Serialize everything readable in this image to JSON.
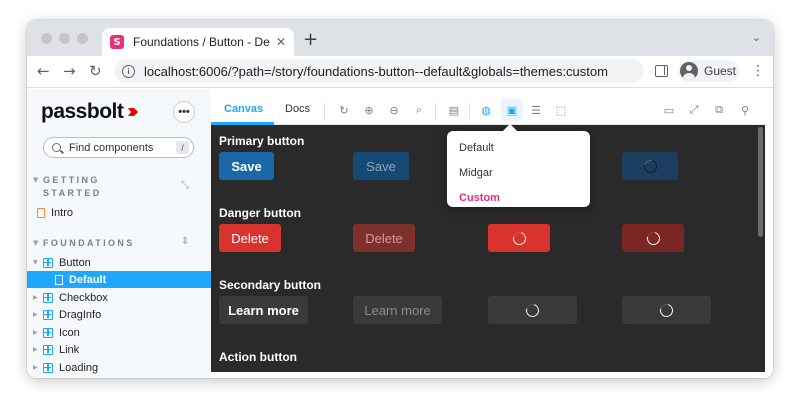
{
  "browser": {
    "tab_title": "Foundations / Button - Default",
    "favicon_letter": "S",
    "url": "localhost:6006/?path=/story/foundations-button--default&globals=themes:custom",
    "profile_label": "Guest"
  },
  "sidebar": {
    "logo": "passbolt",
    "search_placeholder": "Find components",
    "search_shortcut": "/",
    "groups": [
      {
        "label": "GETTING",
        "label2": "STARTED",
        "items": [
          {
            "label": "Intro",
            "icon": "doc-icon"
          }
        ]
      },
      {
        "label": "FOUNDATIONS"
      }
    ],
    "tree": [
      {
        "label": "Button",
        "icon": "component-icon",
        "expanded": true
      },
      {
        "label": "Default",
        "icon": "story-icon",
        "selected": true
      },
      {
        "label": "Checkbox",
        "icon": "component-icon"
      },
      {
        "label": "DragInfo",
        "icon": "component-icon"
      },
      {
        "label": "Icon",
        "icon": "component-icon"
      },
      {
        "label": "Link",
        "icon": "component-icon"
      },
      {
        "label": "Loading",
        "icon": "component-icon"
      }
    ]
  },
  "toolbar": {
    "tabs": [
      "Canvas",
      "Docs"
    ],
    "active_tab": "Canvas"
  },
  "theme_menu": {
    "options": [
      "Default",
      "Midgar",
      "Custom"
    ],
    "selected": "Custom"
  },
  "canvas": {
    "sections": [
      {
        "title": "Primary button",
        "label": "Save"
      },
      {
        "title": "Danger button",
        "label": "Delete"
      },
      {
        "title": "Secondary button",
        "label": "Learn more"
      },
      {
        "title": "Action button"
      }
    ]
  },
  "colors": {
    "accent": "#1ea7fd",
    "brand": "#e6317a",
    "primary": "#1b68a8",
    "danger": "#d9332d",
    "canvas_bg": "#2a2a2a"
  }
}
